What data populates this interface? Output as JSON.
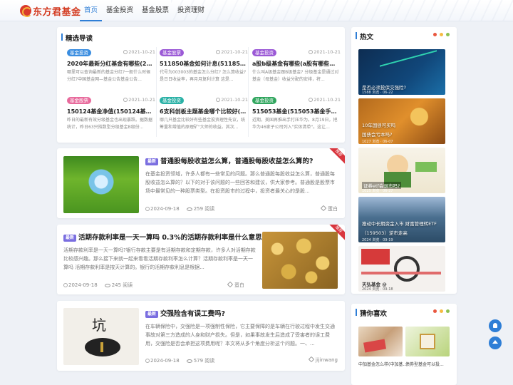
{
  "site": {
    "logo_text": "东方君基金",
    "nav": [
      "首页",
      "基金投资",
      "基金股票",
      "投资理财"
    ]
  },
  "featured": {
    "title": "精选导读",
    "items": [
      {
        "tag": "基金投资",
        "tag_color": "blue",
        "date": "2021-10-21",
        "title": "2020年最新分红基金有哪些(2020年...",
        "desc": "哪里可以查询最新的基金分红?一般什么时候分红?中国基金网—基金公告基金公告..."
      },
      {
        "tag": "基金股票",
        "tag_color": "purple",
        "date": "2021-10-21",
        "title": "511850基金如何计息(511850货币基金...",
        "desc": "代号为003003的基金怎么分红? 怎么算收益? 是日日收益率，再月月复利计算 这是..."
      },
      {
        "tag": "基金投资",
        "tag_color": "purple",
        "date": "2021-10-21",
        "title": "a股b级基金有哪些(a股有哪些比较好...",
        "desc": "什么叫A级基金跟B级基金? 分级基金是通过对基金（母基金）收益分配的安排，将..."
      },
      {
        "tag": "基金股票",
        "tag_color": "pink",
        "date": "2021-10-21",
        "title": "150124基金净值(150124基金净值查询)",
        "desc": "昨日的最新有效分级基金也出现暴跌。据数据统计，昨日63只指数型分级基金B级份..."
      },
      {
        "tag": "基金投资",
        "tag_color": "teal",
        "date": "2021-10-21",
        "title": "6支科创板主题基金哪个比较好(科...",
        "desc": "哪几只基金比较好有些基金投资理性先议，统筹量和增值的原理矿\"大师的收益。其次..."
      },
      {
        "tag": "基金投资",
        "tag_color": "green",
        "date": "2021-10-21",
        "title": "515053基金(515053基金手续费多少)",
        "desc": "近期，美国再推出手打压华为。8月19日，把华为46家子公司列入\"实体清单\"。这让..."
      }
    ]
  },
  "articles": [
    {
      "tag": "最新",
      "title": "普通股每股收益怎么算，普通股每股收益怎么算的?",
      "desc": "在基金投资领域，许多人都有一些常见的问题。那么普通股每股收益怎么算，普通股每股收益怎么算的？以下的对于该问题的一些回答和建议，供大家参考。普通股是股票市场中最常见的一种股票类型。在投资股市的过程中，投资者最关心的是股...",
      "date": "2024-09-18",
      "views": "259 阅读",
      "author": "蛋白",
      "ribbon": "推荐"
    },
    {
      "tag": "最新",
      "title": "活期存款利率是一天一算吗 0.3%的活期存款利率是什么意思",
      "desc": "活期存款利率是一天一算吗?银行存款主要是有活期存款和定期存款，许多人对活期存款比较感兴趣。那么接下来就一起来看看活期存款利率怎么计算？活期存款利率是一天一算吗 活期存款利率是按天计算的。银行的活期存款利息是根据...",
      "date": "2024-09-18",
      "views": "245 阅读",
      "author": "蛋白",
      "ribbon": "推荐"
    },
    {
      "tag": "最新",
      "title": "交强险含有误工费吗?",
      "desc": "在车辆保险中，交强险是一项强制性保险，它主要保障的是车辆在行驶过程中发生交通事故对第三方造成的人身和财产损失。但是，如果事故发生后造成了受害者的误工费用，交强险是否会承担这项费用呢？本文将从多个角度分析这个问题。一、...",
      "date": "2024-09-18",
      "views": "579 阅读",
      "author": "jijinwang"
    }
  ],
  "hot": {
    "title": "热文",
    "items": [
      {
        "caption": "是否必须投保交强险?",
        "meta": "1588 浏览 · 06-22"
      },
      {
        "caption": "10年国债可买吗",
        "caption2": "国债会亏本吗?",
        "meta": "1027 浏览 · 06-07"
      },
      {
        "caption": "证券etf会退市吗?",
        "meta": "1025 浏览 · 06-27"
      },
      {
        "caption": "推动中长期资金入市 财富管理转ETF",
        "caption2": "（159503）逆市走高",
        "meta": "2024 浏览 · 09-19"
      },
      {
        "caption": "天弘基金 @",
        "meta": "2024 浏览 · 09-18"
      }
    ]
  },
  "guess": {
    "title": "猜你喜欢",
    "items": [
      {
        "label": "中加基金怎么样(中加基..."
      },
      {
        "label": "债券型基金可以投..."
      }
    ]
  },
  "colors": {
    "accent": "#2e7ed6",
    "dot1": "#e9573f",
    "dot2": "#f6bb42",
    "dot3": "#8cc152"
  }
}
